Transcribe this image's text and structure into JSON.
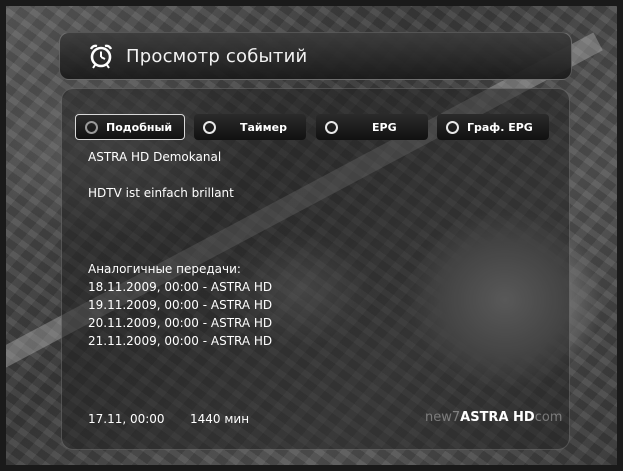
{
  "header": {
    "title": "Просмотр событий",
    "icon": "alarm-clock-icon"
  },
  "buttons": [
    {
      "label": "Подобный",
      "icon": "ring-icon"
    },
    {
      "label": "Таймер",
      "icon": "ring-icon"
    },
    {
      "label": "EPG",
      "icon": "ring-icon"
    },
    {
      "label": "Граф. EPG",
      "icon": "ring-icon"
    }
  ],
  "event": {
    "channel": "ASTRA HD Demokanal",
    "description": "HDTV ist einfach brillant"
  },
  "similar": {
    "heading": "Аналогичные передачи:",
    "items": [
      "18.11.2009, 00:00  -  ASTRA HD",
      "19.11.2009, 00:00  -  ASTRA HD",
      "20.11.2009, 00:00  -  ASTRA HD",
      "21.11.2009, 00:00  -  ASTRA HD"
    ]
  },
  "footer": {
    "datetime": "17.11, 00:00",
    "duration": "1440 мин",
    "channel": "ASTRA HD",
    "watermark_left": "new7",
    "watermark_right": "com"
  },
  "colors": {
    "panel": "#232323",
    "text": "#ffffff"
  }
}
